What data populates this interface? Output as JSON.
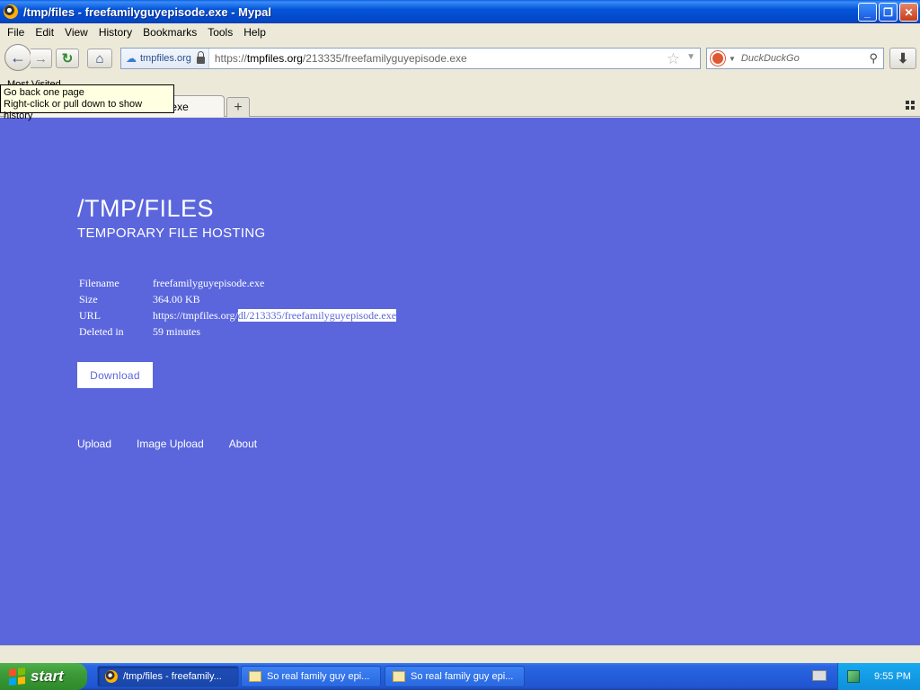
{
  "window": {
    "title": "/tmp/files - freefamilyguyepisode.exe - Mypal",
    "buttons": {
      "minimize": "_",
      "maximize": "❐",
      "close": "✕"
    }
  },
  "menu": [
    "File",
    "Edit",
    "View",
    "History",
    "Bookmarks",
    "Tools",
    "Help"
  ],
  "nav": {
    "identity": "tmpfiles.org",
    "url_prefix": "https://",
    "url_domain": "tmpfiles.org",
    "url_path": "/213335/freefamilyguyepisode.exe",
    "search_placeholder": "DuckDuckGo"
  },
  "bookmarks": {
    "item": "Most Visited"
  },
  "tooltip": {
    "line1": "Go back one page",
    "line2": "Right-click or pull down to show history"
  },
  "tab": {
    "title": "/tmp/files - freefamilyguyepisode.exe",
    "new_tab": "+"
  },
  "page": {
    "title": "/TMP/FILES",
    "subtitle": "TEMPORARY FILE HOSTING",
    "info": {
      "filename_label": "Filename",
      "filename": "freefamilyguyepisode.exe",
      "size_label": "Size",
      "size": "364.00 KB",
      "url_label": "URL",
      "url_plain": "https://tmpfiles.org/",
      "url_selected": "dl/213335/freefamilyguyepisode.exe",
      "deleted_label": "Deleted in",
      "deleted": "59 minutes"
    },
    "download_button": "Download",
    "footer_links": [
      "Upload",
      "Image Upload",
      "About"
    ]
  },
  "taskbar": {
    "start": "start",
    "tasks": [
      "/tmp/files - freefamily...",
      "So real family guy epi...",
      "So real family guy epi..."
    ],
    "clock": "9:55 PM"
  }
}
